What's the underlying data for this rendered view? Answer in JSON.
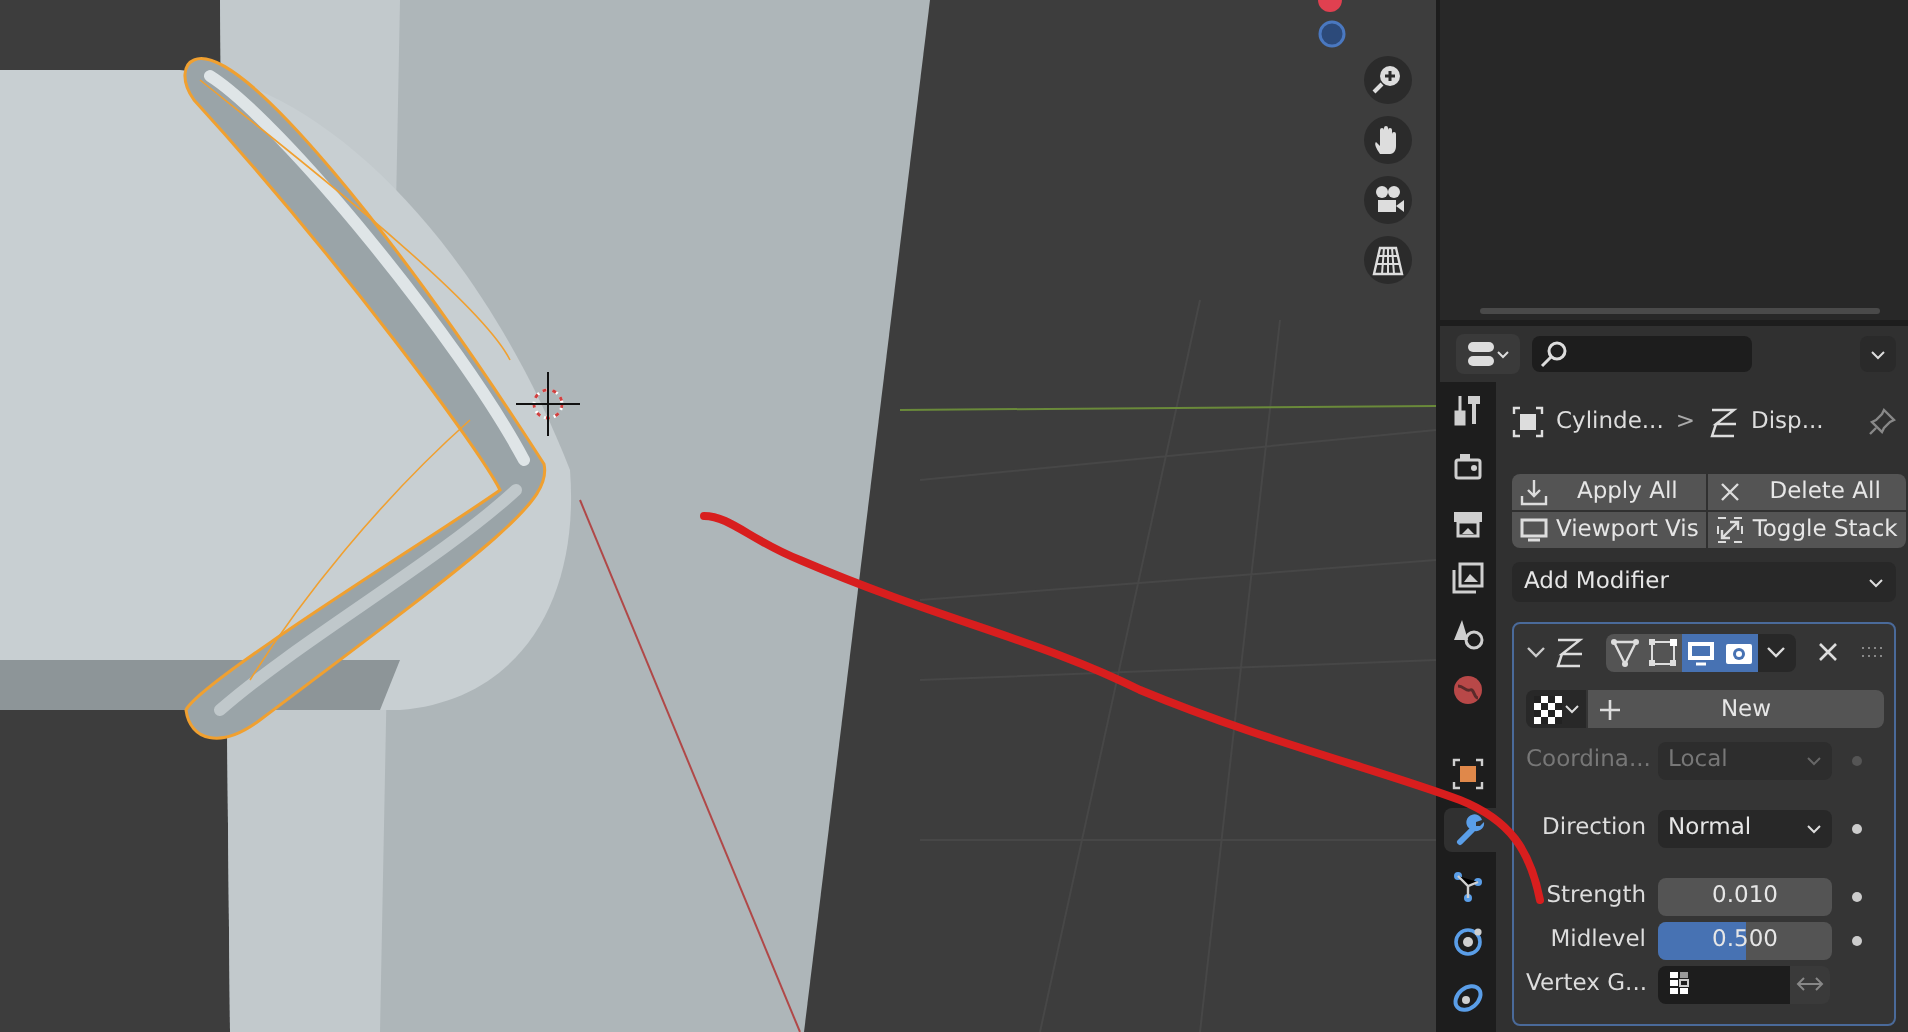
{
  "viewport": {
    "nav_buttons": [
      {
        "kind": "zoom"
      },
      {
        "kind": "pan"
      },
      {
        "kind": "camera"
      },
      {
        "kind": "grid"
      }
    ]
  },
  "properties": {
    "tabs": [
      {
        "kind": "tool",
        "selected": false
      },
      {
        "kind": "render",
        "selected": false
      },
      {
        "kind": "output",
        "selected": false
      },
      {
        "kind": "view_layer",
        "selected": false
      },
      {
        "kind": "scene",
        "selected": false
      },
      {
        "kind": "world",
        "selected": false
      },
      {
        "kind": "object",
        "selected": false
      },
      {
        "kind": "modifiers",
        "selected": true
      },
      {
        "kind": "particles",
        "selected": false
      },
      {
        "kind": "physics",
        "selected": false
      },
      {
        "kind": "constraints",
        "selected": false
      }
    ],
    "breadcrumb_separator": ">",
    "breadcrumb": [
      {
        "kind": "object",
        "label": "Cylinde..."
      },
      {
        "kind": "modifier",
        "label": "Disp..."
      }
    ],
    "actions": [
      {
        "kind": "apply",
        "label": "Apply All"
      },
      {
        "kind": "delete",
        "label": "Delete All"
      },
      {
        "kind": "viewport",
        "label": "Viewport Vis"
      },
      {
        "kind": "toggle",
        "label": "Toggle Stack"
      }
    ],
    "add_modifier": {
      "label": "Add Modifier"
    },
    "modifier": {
      "expanded": true,
      "toggles": [
        {
          "kind": "editmode",
          "on": false
        },
        {
          "kind": "cage",
          "on": false
        },
        {
          "kind": "viewport",
          "on": true
        },
        {
          "kind": "render",
          "on": true
        }
      ],
      "texture": {
        "button": "New"
      },
      "field_groups": [
        [
          {
            "kind": "dropdown",
            "label": "Coordina...",
            "value": "Local",
            "disabled": true
          }
        ],
        [
          {
            "kind": "dropdown",
            "label": "Direction",
            "value": "Normal",
            "disabled": false
          }
        ],
        [
          {
            "kind": "number",
            "label": "Strength",
            "value": "0.010"
          },
          {
            "kind": "slider",
            "label": "Midlevel",
            "value": "0.500",
            "level": 0.5
          },
          {
            "kind": "vertex_group",
            "label": "Vertex G..."
          }
        ]
      ]
    }
  }
}
